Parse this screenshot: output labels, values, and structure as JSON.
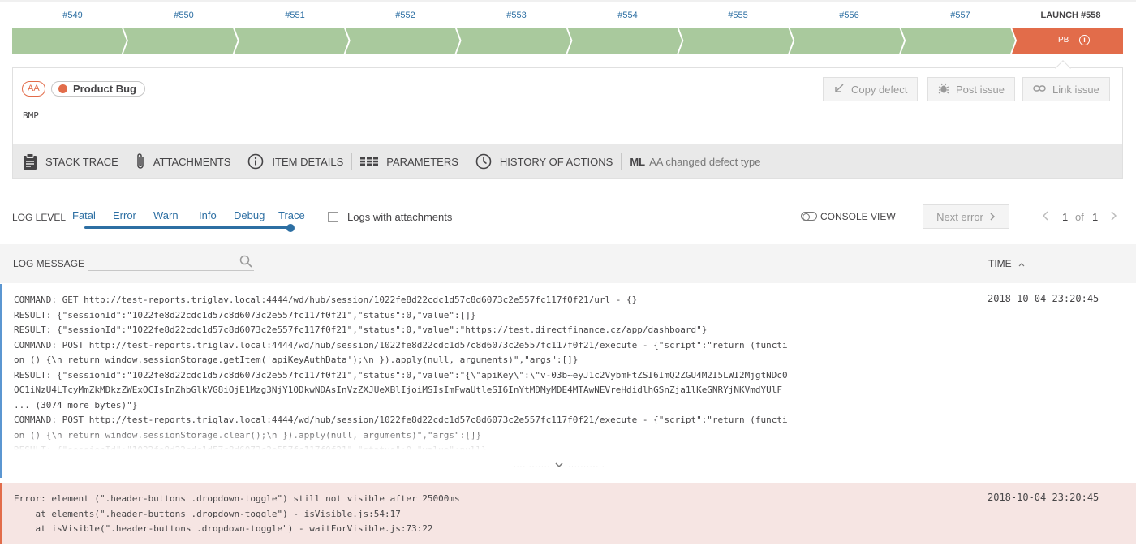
{
  "history": {
    "items": [
      {
        "label": "#549"
      },
      {
        "label": "#550"
      },
      {
        "label": "#551"
      },
      {
        "label": "#552"
      },
      {
        "label": "#553"
      },
      {
        "label": "#554"
      },
      {
        "label": "#555"
      },
      {
        "label": "#556"
      },
      {
        "label": "#557"
      }
    ],
    "current": {
      "label": "LAUNCH #558",
      "short": "PB"
    },
    "colors": {
      "passed": "#a9c99d",
      "current": "#e26c4a"
    }
  },
  "defect": {
    "aa_badge": "AA",
    "type": "Product Bug",
    "comment": "BMP",
    "buttons": {
      "copy": "Copy defect",
      "post": "Post issue",
      "link": "Link issue"
    }
  },
  "tabs": {
    "stack_trace": "STACK TRACE",
    "attachments": "ATTACHMENTS",
    "item_details": "ITEM DETAILS",
    "parameters": "PARAMETERS",
    "history": "HISTORY OF ACTIONS",
    "ml_prefix": "ML",
    "ml_text": "AA changed defect type"
  },
  "toolbar": {
    "log_level_label": "LOG LEVEL",
    "levels": [
      "Fatal",
      "Error",
      "Warn",
      "Info",
      "Debug",
      "Trace"
    ],
    "selected_level": "Trace",
    "attachments_checkbox": "Logs with attachments",
    "attachments_checked": false,
    "console_view": "CONSOLE VIEW",
    "next_error": "Next error",
    "page_current": "1",
    "page_of": "of",
    "page_total": "1"
  },
  "table": {
    "message_header": "LOG MESSAGE",
    "time_header": "TIME",
    "sort_indicator": "^"
  },
  "logs": [
    {
      "level": "debug",
      "message": "COMMAND: GET http://test-reports.triglav.local:4444/wd/hub/session/1022fe8d22cdc1d57c8d6073c2e557fc117f0f21/url - {}\nRESULT: {\"sessionId\":\"1022fe8d22cdc1d57c8d6073c2e557fc117f0f21\",\"status\":0,\"value\":[]}\nRESULT: {\"sessionId\":\"1022fe8d22cdc1d57c8d6073c2e557fc117f0f21\",\"status\":0,\"value\":\"https://test.directfinance.cz/app/dashboard\"}\nCOMMAND: POST http://test-reports.triglav.local:4444/wd/hub/session/1022fe8d22cdc1d57c8d6073c2e557fc117f0f21/execute - {\"script\":\"return (functi\non () {\\n return window.sessionStorage.getItem('apiKeyAuthData');\\n }).apply(null, arguments)\",\"args\":[]}\nRESULT: {\"sessionId\":\"1022fe8d22cdc1d57c8d6073c2e557fc117f0f21\",\"status\":0,\"value\":\"{\\\"apiKey\\\":\\\"v-03b~eyJ1c2VybmFtZSI6ImQ2ZGU4M2I5LWI2MjgtNDc0\nOC1iNzU4LTcyMmZkMDkzZWExOCIsInZhbGlkVG8iOjE1Mzg3NjY1ODkwNDAsInVzZXJUeXBlIjoiMSIsImFwaUtleSI6InYtMDMyMDE4MTAwNEVreHdidlhGSnZja1lKeGNRYjNKVmdYUlF\n... (3074 more bytes)\"}\nCOMMAND: POST http://test-reports.triglav.local:4444/wd/hub/session/1022fe8d22cdc1d57c8d6073c2e557fc117f0f21/execute - {\"script\":\"return (functi\non () {\\n return window.sessionStorage.clear();\\n }).apply(null, arguments)\",\"args\":[]}\nRESULT: {\"sessionId\":\"1022fe8d22cdc1d57c8d6073c2e557fc117f0f21\",\"status\":0,\"value\":null}",
      "time": "2018-10-04 23:20:45",
      "expander": "............"
    },
    {
      "level": "error",
      "message": "Error: element (\".header-buttons .dropdown-toggle\") still not visible after 25000ms\n    at elements(\".header-buttons .dropdown-toggle\") - isVisible.js:54:17\n    at isVisible(\".header-buttons .dropdown-toggle\") - waitForVisible.js:73:22",
      "time": "2018-10-04 23:20:45"
    }
  ]
}
